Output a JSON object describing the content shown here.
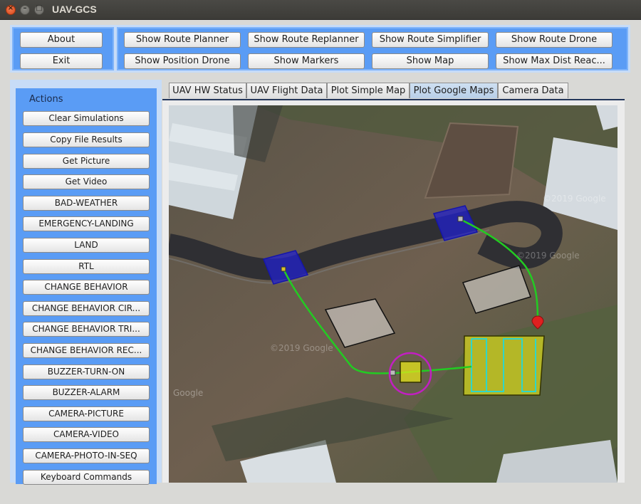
{
  "window": {
    "title": "UAV-GCS"
  },
  "top_left_buttons": [
    "About",
    "Exit"
  ],
  "top_buttons": [
    "Show Route Planner",
    "Show Route Replanner",
    "Show Route Simplifier",
    "Show Route Drone",
    "Show Position Drone",
    "Show Markers",
    "Show Map",
    "Show Max Dist Reac..."
  ],
  "sidebar": {
    "title": "Actions",
    "items": [
      "Clear Simulations",
      "Copy File Results",
      "Get Picture",
      "Get Video",
      "BAD-WEATHER",
      "EMERGENCY-LANDING",
      "LAND",
      "RTL",
      "CHANGE BEHAVIOR",
      "CHANGE BEHAVIOR CIR...",
      "CHANGE BEHAVIOR TRI...",
      "CHANGE BEHAVIOR REC...",
      "BUZZER-TURN-ON",
      "BUZZER-ALARM",
      "CAMERA-PICTURE",
      "CAMERA-VIDEO",
      "CAMERA-PHOTO-IN-SEQ",
      "Keyboard Commands"
    ]
  },
  "tabs": [
    "UAV HW Status",
    "UAV Flight Data",
    "Plot Simple Map",
    "Plot Google Maps",
    "Camera Data"
  ],
  "active_tab": "Plot Google Maps",
  "map": {
    "watermarks": [
      "©2019 Google",
      "©2019 Google",
      "©2019 Google",
      "Google"
    ],
    "colors": {
      "route": "#22cc22",
      "nofly": "#2222cc",
      "obstacle": "#ffffff",
      "target": "#e6e61a",
      "scan": "#2fd6c8",
      "circle": "#c21fc2",
      "marker": "#e02020"
    }
  }
}
